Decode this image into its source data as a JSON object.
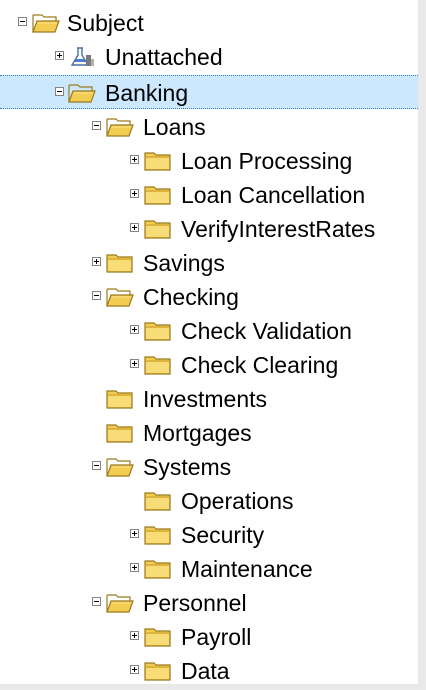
{
  "tree": {
    "root": {
      "label": "Subject",
      "state": "expanded"
    },
    "unattached": {
      "label": "Unattached",
      "state": "collapsed"
    },
    "banking": {
      "label": "Banking",
      "state": "expanded",
      "selected": true,
      "children": {
        "loans": {
          "label": "Loans",
          "state": "expanded",
          "children": {
            "loan_processing": {
              "label": "Loan Processing",
              "state": "collapsed"
            },
            "loan_cancellation": {
              "label": "Loan Cancellation",
              "state": "collapsed"
            },
            "verify_interest_rates": {
              "label": "VerifyInterestRates",
              "state": "collapsed"
            }
          }
        },
        "savings": {
          "label": "Savings",
          "state": "collapsed"
        },
        "checking": {
          "label": "Checking",
          "state": "expanded",
          "children": {
            "check_validation": {
              "label": "Check Validation",
              "state": "collapsed"
            },
            "check_clearing": {
              "label": "Check Clearing",
              "state": "collapsed"
            }
          }
        },
        "investments": {
          "label": "Investments",
          "state": "leaf"
        },
        "mortgages": {
          "label": "Mortgages",
          "state": "leaf"
        },
        "systems": {
          "label": "Systems",
          "state": "expanded",
          "children": {
            "operations": {
              "label": "Operations",
              "state": "leaf"
            },
            "security": {
              "label": "Security",
              "state": "collapsed"
            },
            "maintenance": {
              "label": "Maintenance",
              "state": "collapsed"
            }
          }
        },
        "personnel": {
          "label": "Personnel",
          "state": "expanded",
          "children": {
            "payroll": {
              "label": "Payroll",
              "state": "collapsed"
            },
            "data": {
              "label": "Data",
              "state": "collapsed"
            }
          }
        }
      }
    }
  },
  "colors": {
    "selection_background": "#cce8ff",
    "selection_border": "#3a78c9",
    "folder_fill": "#f2cd52",
    "folder_outline": "#9a7a1c",
    "panel_background": "#ffffff",
    "window_background": "#e9e9e9"
  },
  "icons": {
    "folder": "folder-icon",
    "folder_open": "folder-open-icon",
    "unattached": "flask-icon"
  }
}
